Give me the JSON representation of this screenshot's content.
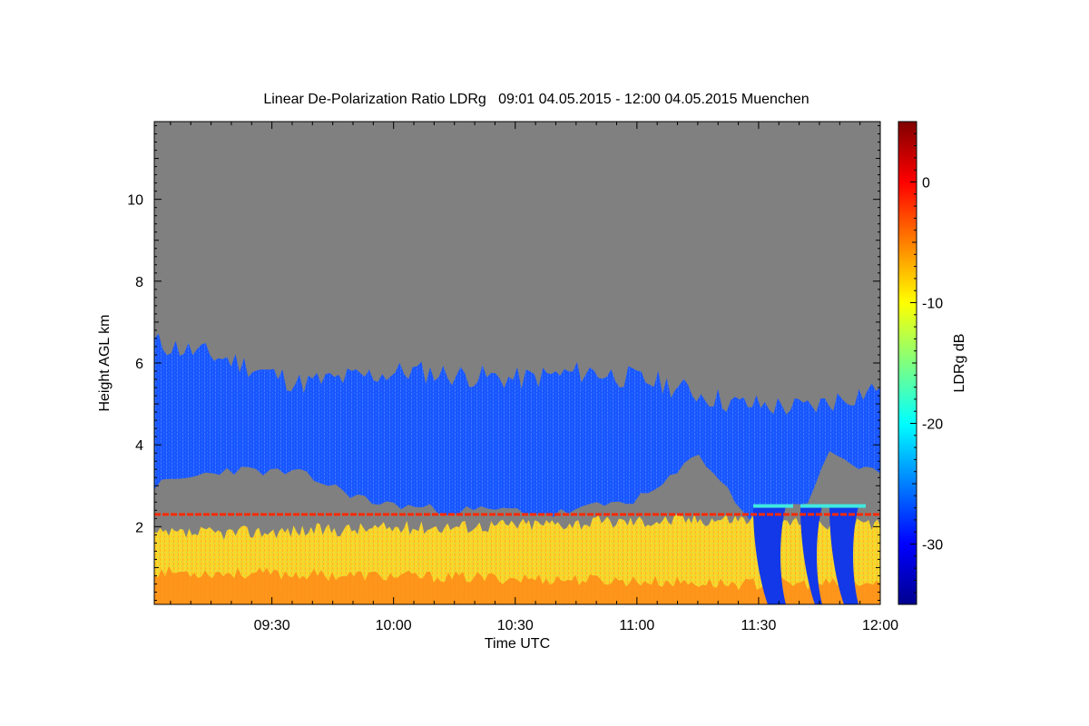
{
  "chart_data": {
    "type": "heatmap",
    "title": "Linear De-Polarization Ratio LDRg   09:01 04.05.2015 - 12:00 04.05.2015 Muenchen",
    "xlabel": "Time UTC",
    "ylabel": "Height AGL km",
    "x_range": [
      "09:01",
      "12:00"
    ],
    "x_ticks": [
      "09:30",
      "10:00",
      "10:30",
      "11:00",
      "11:30",
      "12:00"
    ],
    "y_range_km": [
      0.1,
      11.9
    ],
    "y_ticks": [
      2,
      4,
      6,
      8,
      10
    ],
    "colorbar": {
      "label": "LDRg dB",
      "range_db": [
        -35,
        5
      ],
      "ticks": [
        0,
        -10,
        -20,
        -30
      ],
      "colormap": "jet"
    },
    "colors": {
      "no_data": "#808080",
      "cirrus_layer": "#1a55ff",
      "boundary_layer_low": "#ffcc20",
      "surface_layer": "#ff7a10",
      "artifact_line": "#ff2a00"
    },
    "regions": {
      "cirrus_top_km": [
        [
          0,
          6.5
        ],
        [
          0.1,
          6.1
        ],
        [
          0.2,
          5.5
        ],
        [
          0.35,
          5.8
        ],
        [
          0.5,
          5.6
        ],
        [
          0.6,
          5.8
        ],
        [
          0.7,
          5.5
        ],
        [
          0.8,
          5.0
        ],
        [
          0.9,
          4.9
        ],
        [
          1,
          5.4
        ]
      ],
      "cirrus_base_km": [
        [
          0,
          3.0
        ],
        [
          0.1,
          3.4
        ],
        [
          0.2,
          3.3
        ],
        [
          0.3,
          2.6
        ],
        [
          0.4,
          2.4
        ],
        [
          0.5,
          2.4
        ],
        [
          0.55,
          2.3
        ],
        [
          0.67,
          2.7
        ],
        [
          0.7,
          3.0
        ],
        [
          0.72,
          3.3
        ],
        [
          0.75,
          3.8
        ],
        [
          0.82,
          2.2
        ],
        [
          0.9,
          2.6
        ],
        [
          0.93,
          3.9
        ],
        [
          0.96,
          3.4
        ],
        [
          1,
          3.3
        ]
      ],
      "boundary_layer_top_km": [
        [
          0,
          1.8
        ],
        [
          0.2,
          1.9
        ],
        [
          0.4,
          2.0
        ],
        [
          0.6,
          2.1
        ],
        [
          0.8,
          2.2
        ],
        [
          1,
          2.0
        ]
      ],
      "surface_layer_top_km": [
        [
          0,
          0.9
        ],
        [
          0.3,
          0.8
        ],
        [
          0.6,
          0.7
        ],
        [
          0.8,
          0.6
        ],
        [
          1,
          0.6
        ]
      ],
      "artifact_line_km": 2.3,
      "fall_streaks_time_frac": [
        [
          0.825,
          0.87
        ],
        [
          0.89,
          0.92
        ],
        [
          0.93,
          0.97
        ]
      ]
    }
  }
}
